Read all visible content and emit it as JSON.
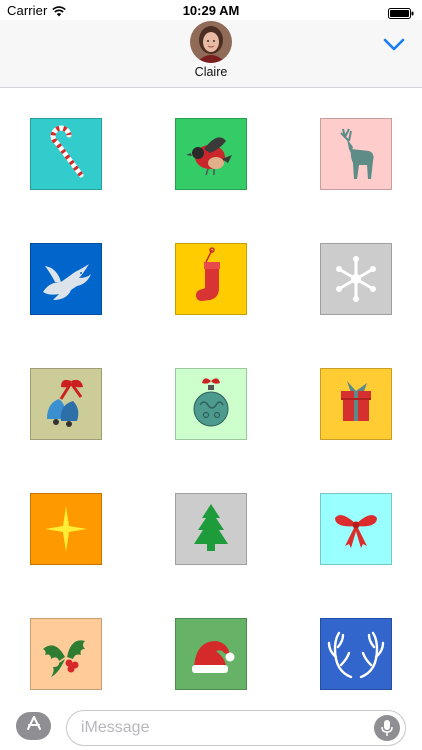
{
  "status_bar": {
    "carrier": "Carrier",
    "time": "10:29 AM",
    "wifi_icon": "wifi-icon",
    "battery_icon": "battery-icon"
  },
  "header": {
    "contact_name": "Claire",
    "collapse_icon": "chevron-down-icon",
    "accent_color": "#1a7cf5"
  },
  "stickers": [
    {
      "icon": "candy-cane-icon",
      "bg": "#33cccc"
    },
    {
      "icon": "bird-icon",
      "bg": "#33cc66"
    },
    {
      "icon": "reindeer-icon",
      "bg": "#ffcccc"
    },
    {
      "icon": "dove-icon",
      "bg": "#0066cc"
    },
    {
      "icon": "stocking-icon",
      "bg": "#ffcc00"
    },
    {
      "icon": "snowflake-icon",
      "bg": "#cccccc"
    },
    {
      "icon": "bells-icon",
      "bg": "#cccc99"
    },
    {
      "icon": "ornament-icon",
      "bg": "#ccffcc"
    },
    {
      "icon": "gift-icon",
      "bg": "#ffcc33"
    },
    {
      "icon": "star-icon",
      "bg": "#ff9900"
    },
    {
      "icon": "christmas-tree-icon",
      "bg": "#cccccc"
    },
    {
      "icon": "bow-icon",
      "bg": "#99ffff"
    },
    {
      "icon": "holly-icon",
      "bg": "#ffcc99"
    },
    {
      "icon": "santa-hat-icon",
      "bg": "#66b266"
    },
    {
      "icon": "antlers-icon",
      "bg": "#3366cc"
    }
  ],
  "input_bar": {
    "placeholder": "iMessage",
    "apps_icon": "app-store-icon",
    "mic_icon": "microphone-icon"
  }
}
